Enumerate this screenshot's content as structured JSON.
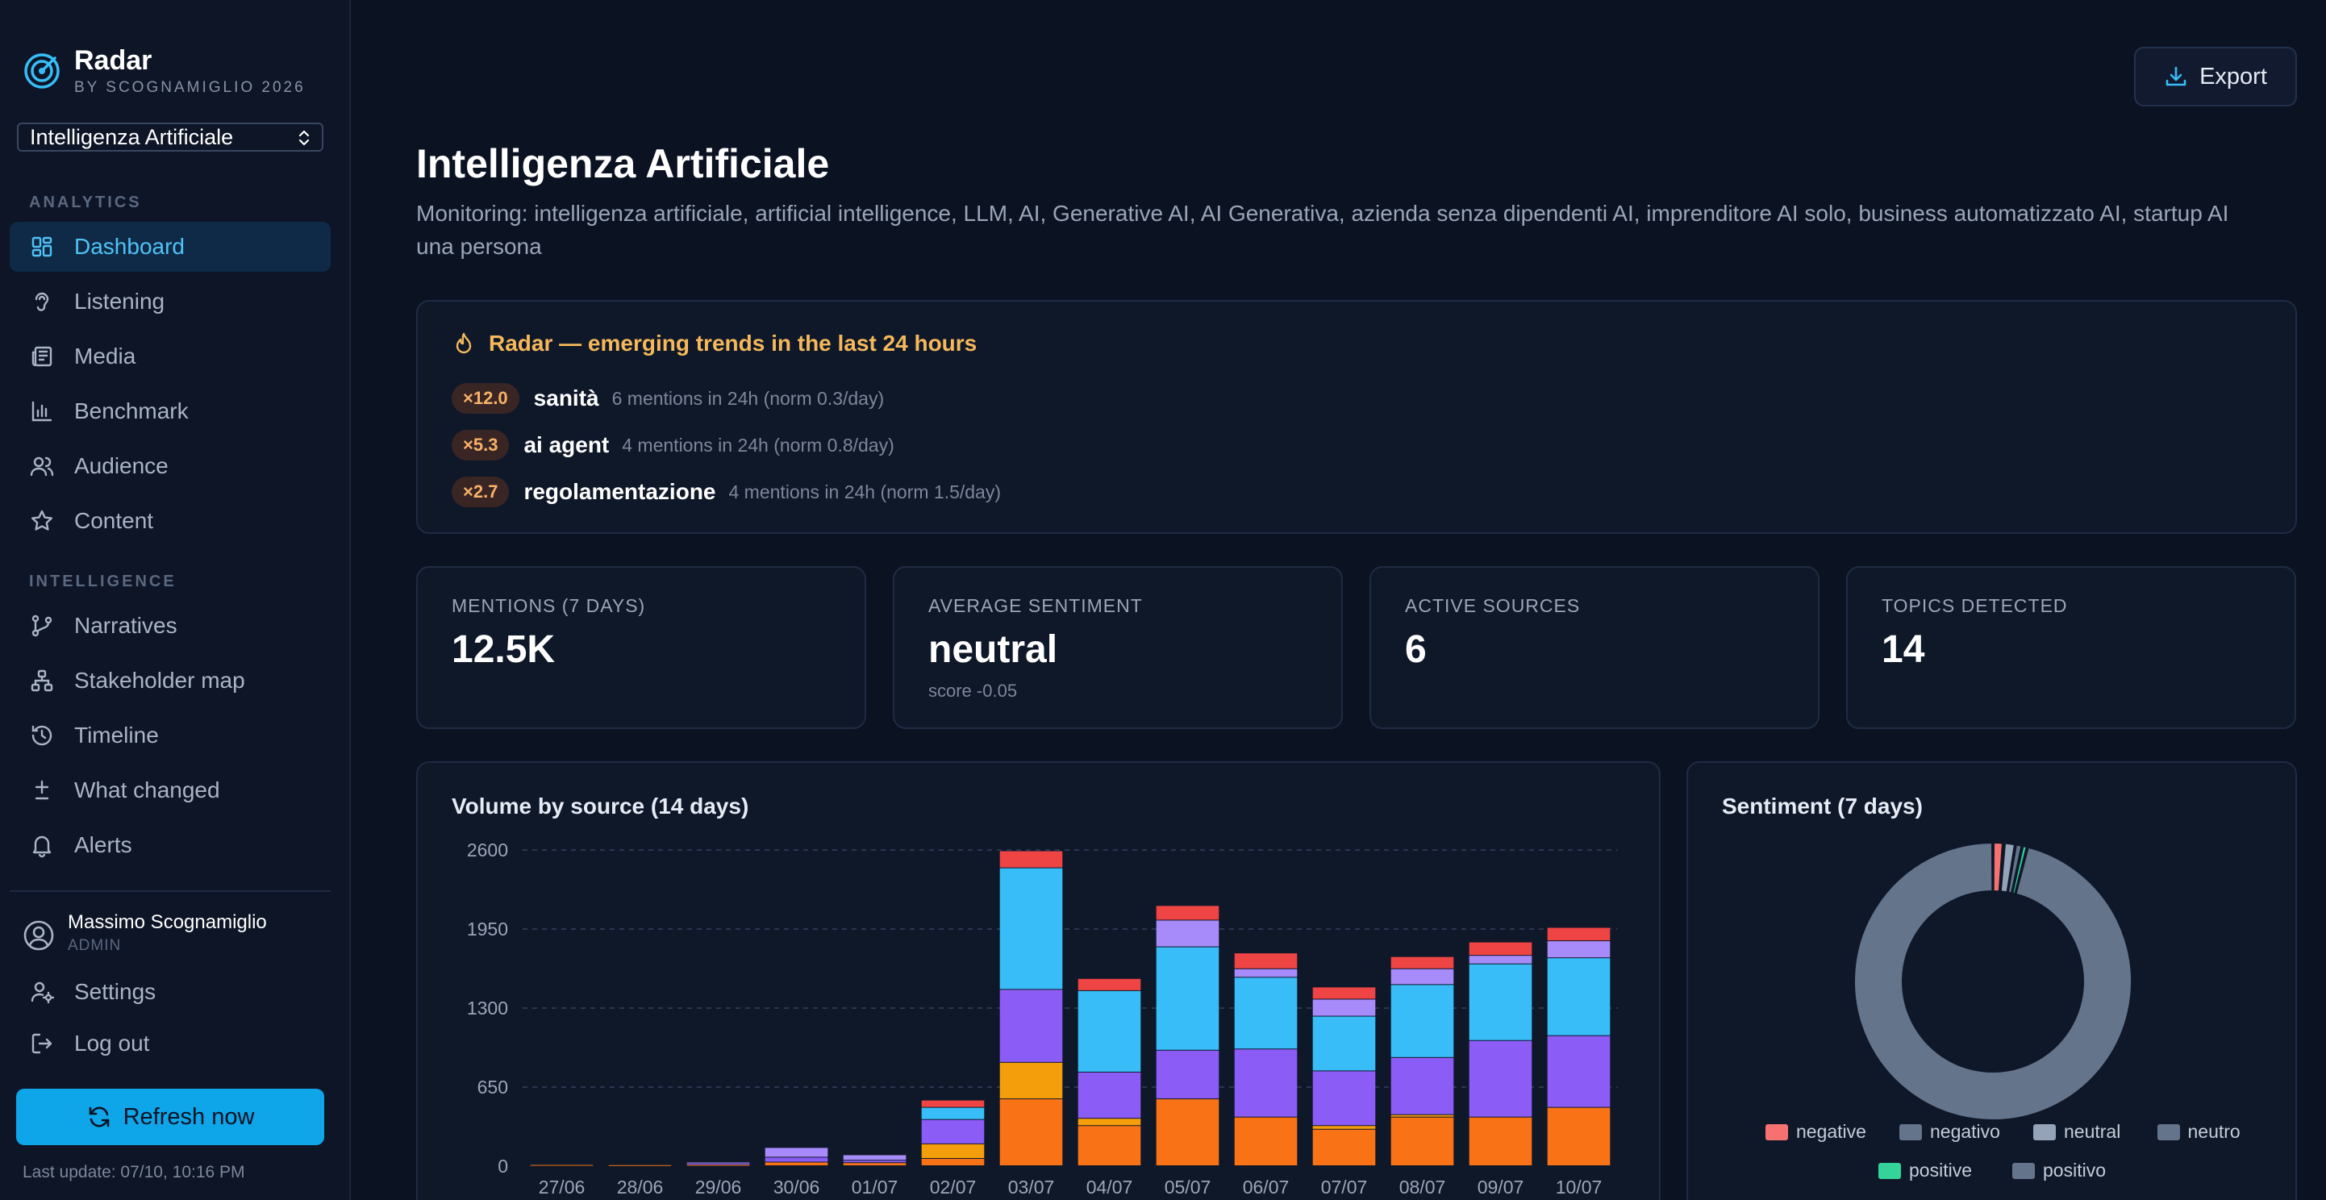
{
  "app": {
    "name": "Radar",
    "byline": "BY SCOGNAMIGLIO 2026",
    "project": "Intelligenza Artificiale"
  },
  "sidebar": {
    "sections": {
      "analytics": "ANALYTICS",
      "intelligence": "INTELLIGENCE"
    },
    "items": [
      {
        "label": "Dashboard",
        "icon": "dashboard-icon",
        "active": true
      },
      {
        "label": "Listening",
        "icon": "ear-icon"
      },
      {
        "label": "Media",
        "icon": "newspaper-icon"
      },
      {
        "label": "Benchmark",
        "icon": "bar-chart-icon"
      },
      {
        "label": "Audience",
        "icon": "users-icon"
      },
      {
        "label": "Content",
        "icon": "star-icon"
      },
      {
        "label": "Narratives",
        "icon": "branch-icon"
      },
      {
        "label": "Stakeholder map",
        "icon": "network-icon"
      },
      {
        "label": "Timeline",
        "icon": "history-icon"
      },
      {
        "label": "What changed",
        "icon": "diff-icon"
      },
      {
        "label": "Alerts",
        "icon": "bell-icon"
      }
    ],
    "user": {
      "name": "Massimo Scognamiglio",
      "role": "ADMIN"
    },
    "settings_label": "Settings",
    "logout_label": "Log out",
    "refresh_label": "Refresh now",
    "last_update": "Last update: 07/10, 10:16 PM"
  },
  "header": {
    "export_label": "Export",
    "title": "Intelligenza Artificiale",
    "description": "Monitoring: intelligenza artificiale, artificial intelligence, LLM, AI, Generative AI, AI Generativa, azienda senza dipendenti AI, imprenditore AI solo, business automatizzato AI, startup AI una persona"
  },
  "trends": {
    "title": "Radar — emerging trends in the last 24 hours",
    "items": [
      {
        "badge": "×12.0",
        "term": "sanità",
        "meta": "6 mentions in 24h (norm 0.3/day)"
      },
      {
        "badge": "×5.3",
        "term": "ai agent",
        "meta": "4 mentions in 24h (norm 0.8/day)"
      },
      {
        "badge": "×2.7",
        "term": "regolamentazione",
        "meta": "4 mentions in 24h (norm 1.5/day)"
      }
    ]
  },
  "kpis": [
    {
      "label": "MENTIONS (7 DAYS)",
      "value": "12.5K",
      "sub": ""
    },
    {
      "label": "AVERAGE SENTIMENT",
      "value": "neutral",
      "sub": "score -0.05"
    },
    {
      "label": "ACTIVE SOURCES",
      "value": "6",
      "sub": ""
    },
    {
      "label": "TOPICS DETECTED",
      "value": "14",
      "sub": ""
    }
  ],
  "colors": {
    "accent": "#0ea5e9",
    "orange": "#f97316",
    "amber": "#f59e0b",
    "purple": "#8b5cf6",
    "cyan": "#38bdf8",
    "lavender": "#a78bfa",
    "red": "#ef4444"
  },
  "chart_data": [
    {
      "type": "bar",
      "stacked": true,
      "title": "Volume by source (14 days)",
      "categories": [
        "27/06",
        "28/06",
        "29/06",
        "30/06",
        "01/07",
        "02/07",
        "03/07",
        "04/07",
        "05/07",
        "06/07",
        "07/07",
        "08/07",
        "09/07",
        "10/07"
      ],
      "ylim": [
        0,
        2600
      ],
      "yticks": [
        0,
        650,
        1300,
        1950,
        2600
      ],
      "grid": true,
      "series": [
        {
          "color": "#f97316",
          "values": [
            10,
            8,
            10,
            30,
            25,
            60,
            550,
            330,
            550,
            400,
            300,
            400,
            400,
            480
          ]
        },
        {
          "color": "#f59e0b",
          "values": [
            0,
            0,
            0,
            0,
            0,
            120,
            300,
            60,
            0,
            0,
            30,
            20,
            0,
            0
          ]
        },
        {
          "color": "#8b5cf6",
          "values": [
            0,
            0,
            10,
            40,
            20,
            200,
            600,
            380,
            400,
            560,
            450,
            470,
            630,
            590
          ]
        },
        {
          "color": "#38bdf8",
          "values": [
            0,
            0,
            0,
            0,
            0,
            100,
            1000,
            670,
            850,
            590,
            450,
            600,
            630,
            640
          ]
        },
        {
          "color": "#a78bfa",
          "values": [
            0,
            0,
            10,
            80,
            45,
            0,
            0,
            0,
            220,
            70,
            140,
            130,
            70,
            140
          ]
        },
        {
          "color": "#ef4444",
          "values": [
            0,
            0,
            0,
            0,
            0,
            60,
            140,
            100,
            120,
            130,
            100,
            100,
            110,
            110
          ]
        }
      ]
    },
    {
      "type": "pie",
      "donut": true,
      "title": "Sentiment (7 days)",
      "legend_position": "bottom",
      "slices": [
        {
          "label": "negative",
          "value": 1.2,
          "color": "#f87171"
        },
        {
          "label": "negativo",
          "value": 0.1,
          "color": "#64748b"
        },
        {
          "label": "neutral",
          "value": 1.3,
          "color": "#94a3b8"
        },
        {
          "label": "neutro",
          "value": 0.8,
          "color": "#64748b"
        },
        {
          "label": "positive",
          "value": 0.6,
          "color": "#34d399"
        },
        {
          "label": "positivo",
          "value": 96.0,
          "color": "#64748b"
        }
      ]
    }
  ]
}
